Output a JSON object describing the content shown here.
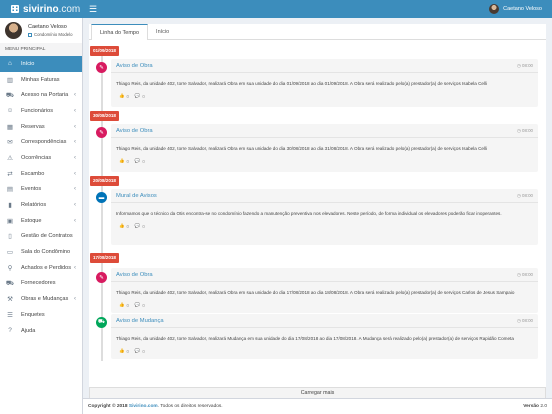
{
  "brand": {
    "name": "sivirino",
    "tld": ".com"
  },
  "header": {
    "user_name": "Caetano Veloso"
  },
  "sidebar": {
    "user_name": "Caetano Veloso",
    "condominio": "Condomínio Modelo",
    "menu_title": "MENU PRINCIPAL",
    "items": [
      {
        "label": "Início",
        "icon": "home-icon",
        "glyph": "⌂",
        "chev": false
      },
      {
        "label": "Minhas Faturas",
        "icon": "barcode-icon",
        "glyph": "▥",
        "chev": false
      },
      {
        "label": "Acesso na Portaria",
        "icon": "car-icon",
        "glyph": "⛟",
        "chev": true
      },
      {
        "label": "Funcionários",
        "icon": "users-icon",
        "glyph": "☺",
        "chev": true
      },
      {
        "label": "Reservas",
        "icon": "calendar-check-icon",
        "glyph": "▦",
        "chev": true
      },
      {
        "label": "Correspondências",
        "icon": "envelope-icon",
        "glyph": "✉",
        "chev": true
      },
      {
        "label": "Ocorrências",
        "icon": "warning-icon",
        "glyph": "⚠",
        "chev": true
      },
      {
        "label": "Escambo",
        "icon": "exchange-icon",
        "glyph": "⇄",
        "chev": true
      },
      {
        "label": "Eventos",
        "icon": "calendar-icon",
        "glyph": "▤",
        "chev": true
      },
      {
        "label": "Relatórios",
        "icon": "chart-icon",
        "glyph": "▮",
        "chev": true
      },
      {
        "label": "Estoque",
        "icon": "box-icon",
        "glyph": "▣",
        "chev": true
      },
      {
        "label": "Gestão de Contratos",
        "icon": "file-icon",
        "glyph": "▯",
        "chev": false
      },
      {
        "label": "Sala do Condômino",
        "icon": "chat-icon",
        "glyph": "▭",
        "chev": false
      },
      {
        "label": "Achados e Perdidos",
        "icon": "search-icon",
        "glyph": "⚲",
        "chev": true
      },
      {
        "label": "Fornecedores",
        "icon": "truck-icon",
        "glyph": "⛟",
        "chev": false
      },
      {
        "label": "Obras e Mudanças",
        "icon": "wrench-icon",
        "glyph": "⚒",
        "chev": true
      },
      {
        "label": "Enquetes",
        "icon": "list-icon",
        "glyph": "☰",
        "chev": false
      },
      {
        "label": "Ajuda",
        "icon": "help-icon",
        "glyph": "?",
        "chev": false
      }
    ]
  },
  "tabs": [
    {
      "label": "Linha do Tempo",
      "active": true
    },
    {
      "label": "Início",
      "active": false
    }
  ],
  "timeline": {
    "entries": [
      {
        "date": "01/09/2018",
        "title": "Aviso de Obra",
        "time": "08:00",
        "bubble": "pink",
        "icon": "wrench-icon",
        "glyph": "✎",
        "text": "Thiago Reis, da unidade 402, torre Salvador, realizará Obra em sua unidade do dia 01/09/2018 ao dia 01/09/2018. A Obra será realizado pelo(a) prestador(a) de serviços Isabela Celli",
        "likes": "0",
        "comments": "0"
      },
      {
        "date": "30/08/2018",
        "title": "Aviso de Obra",
        "time": "08:00",
        "bubble": "pink",
        "icon": "wrench-icon",
        "glyph": "✎",
        "text": "Thiago Reis, da unidade 402, torre Salvador, realizará Obra em sua unidade do dia 30/08/2018 ao dia 31/08/2018. A Obra será realizado pelo(a) prestador(a) de serviços Isabela Celli",
        "likes": "0",
        "comments": "0"
      },
      {
        "date": "20/08/2018",
        "title": "Mural de Avisos",
        "time": "08:00",
        "bubble": "blue",
        "icon": "notice-icon",
        "glyph": "▬",
        "text": "Informamos que o técnico da Otis encontra-se no condomínio fazendo a manutenção preventiva nos elevadores. Neste período, de forma individual os elevadores poderão ficar inoperantes.",
        "likes": "0",
        "comments": "0"
      },
      {
        "date": "17/08/2018",
        "title": "Aviso de Obra",
        "time": "08:00",
        "bubble": "pink",
        "icon": "wrench-icon",
        "glyph": "✎",
        "text": "Thiago Reis, da unidade 402, torre Salvador, realizará Obra em sua unidade do dia 17/08/2018 ao dia 18/08/2018. A Obra será realizado pelo(a) prestador(a) de serviços Carlos de Jesus Sampaio",
        "likes": "0",
        "comments": "0"
      },
      {
        "date": "",
        "title": "Aviso de Mudança",
        "time": "08:00",
        "bubble": "green",
        "icon": "truck-icon",
        "glyph": "⛟",
        "text": "Thiago Reis, da unidade 402, torre Salvador, realizará Mudança em sua unidade do dia 17/08/2018 ao dia 17/08/2018. A Mudança será realizado pelo(a) prestador(a) de serviços Rapidão Cometa",
        "likes": "0",
        "comments": "0"
      }
    ],
    "load_more": "Carregar mais"
  },
  "footer": {
    "copyright_prefix": "Copyright © 2018",
    "site": "Sivirino.com",
    "rights": ". Todos os direitos reservados.",
    "version_label": "Versão",
    "version": "2.0"
  },
  "colors": {
    "primary": "#3c8dbc",
    "date_badge": "#dd4b39",
    "pink": "#d81b60",
    "blue": "#0073b7",
    "green": "#00a65a"
  }
}
